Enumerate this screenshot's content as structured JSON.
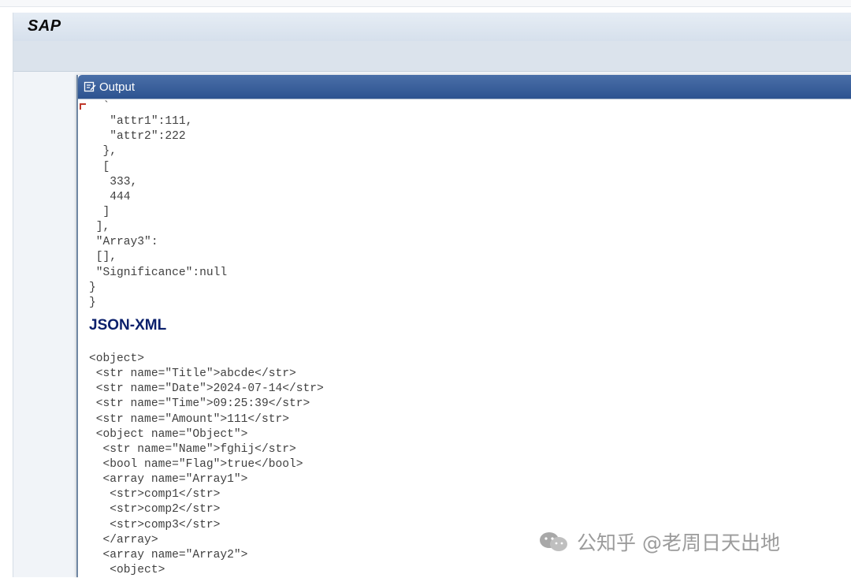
{
  "app": {
    "logo": "SAP"
  },
  "window": {
    "title": "Output"
  },
  "json_lines": [
    "  `",
    "   \"attr1\":111,",
    "   \"attr2\":222",
    "  },",
    "  [",
    "   333,",
    "   444",
    "  ]",
    " ],",
    " \"Array3\":",
    " [],",
    " \"Significance\":null",
    "}",
    "}"
  ],
  "section": {
    "heading": "JSON-XML"
  },
  "xml_lines": [
    "<object>",
    " <str name=\"Title\">abcde</str>",
    " <str name=\"Date\">2024-07-14</str>",
    " <str name=\"Time\">09:25:39</str>",
    " <str name=\"Amount\">111</str>",
    " <object name=\"Object\">",
    "  <str name=\"Name\">fghij</str>",
    "  <bool name=\"Flag\">true</bool>",
    "  <array name=\"Array1\">",
    "   <str>comp1</str>",
    "   <str>comp2</str>",
    "   <str>comp3</str>",
    "  </array>",
    "  <array name=\"Array2\">",
    "   <object>"
  ],
  "watermark": {
    "text": "知乎 @老周日天出地",
    "prefix": "公"
  },
  "icons": {
    "title_icon": "edit-window-icon",
    "watermark_icon": "wechat-icon"
  },
  "colors": {
    "heading": "#0a1f6b",
    "titlebar": "#2d5390",
    "text": "#404040"
  }
}
